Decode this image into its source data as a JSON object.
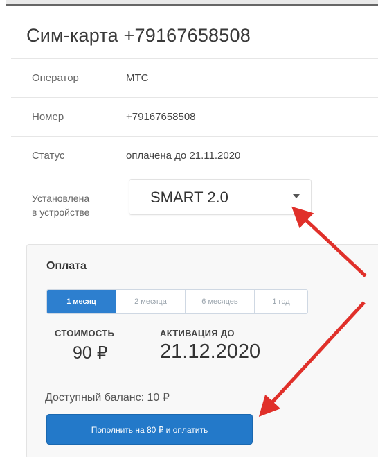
{
  "sim": {
    "title": "Сим-карта +79167658508"
  },
  "details": [
    {
      "label": "Оператор",
      "value": "МТС"
    },
    {
      "label": "Номер",
      "value": "+79167658508"
    },
    {
      "label": "Статус",
      "value": "оплачена до 21.11.2020"
    }
  ],
  "device": {
    "label_line1": "Установлена",
    "label_line2": "в устройстве",
    "selected": "SMART 2.0"
  },
  "payment": {
    "title": "Оплата",
    "tabs": [
      {
        "label": "1 месяц",
        "active": true
      },
      {
        "label": "2 месяца",
        "active": false
      },
      {
        "label": "6 месяцев",
        "active": false
      },
      {
        "label": "1 год",
        "active": false
      }
    ],
    "cost_label": "СТОИМОСТЬ",
    "cost_value": "90 ₽",
    "activation_label": "АКТИВАЦИЯ ДО",
    "activation_value": "21.12.2020",
    "balance_text": "Доступный баланс: 10 ₽",
    "pay_button": "Пополнить на 80 ₽ и оплатить"
  },
  "colors": {
    "accent": "#2379c9",
    "annotation_arrow": "#e0302a"
  }
}
